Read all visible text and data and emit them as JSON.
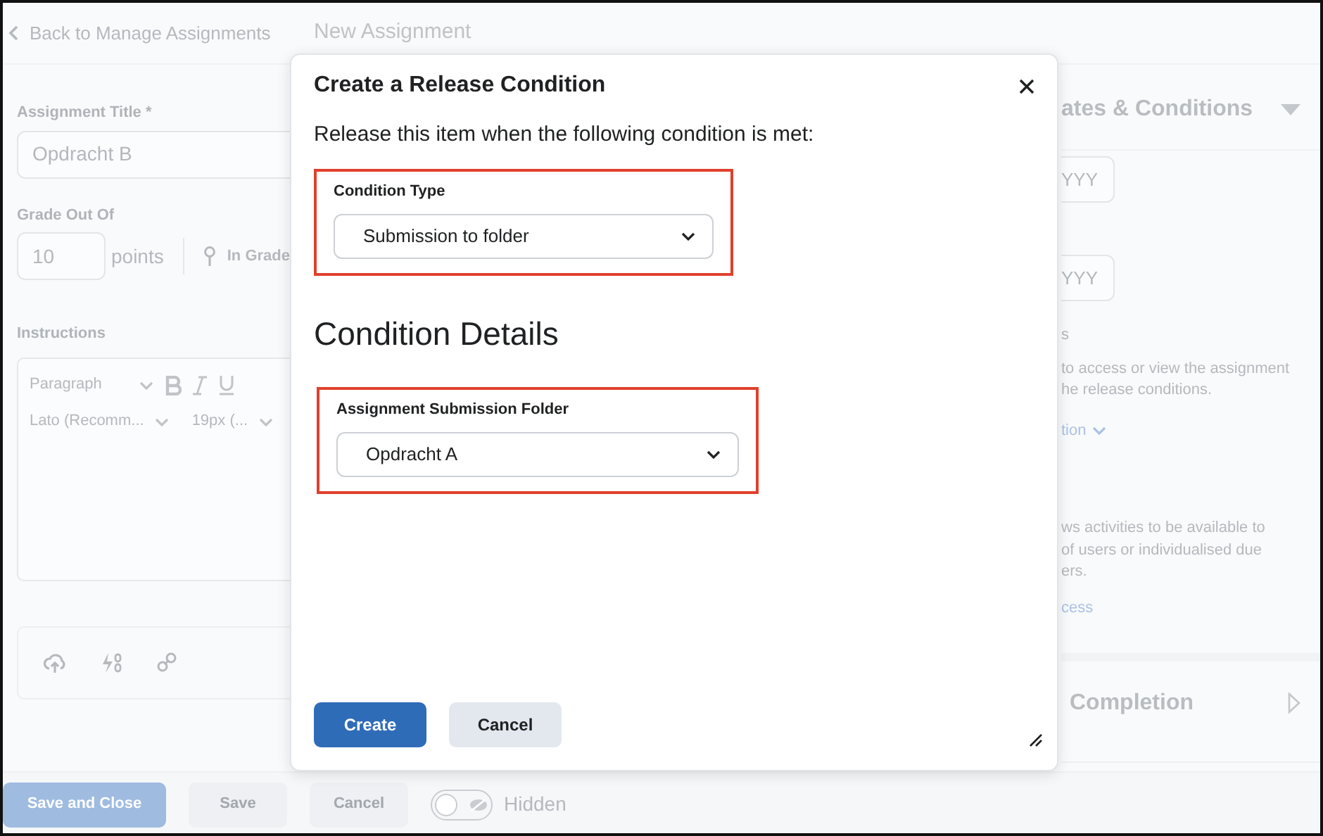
{
  "top_bar": {
    "back_link": "Back to Manage Assignments",
    "page_title": "New Assignment"
  },
  "form": {
    "title_label": "Assignment Title *",
    "title_value": "Opdracht B",
    "grade_label": "Grade Out Of",
    "grade_value": "10",
    "grade_unit": "points",
    "in_grade": "In Grade",
    "instructions_label": "Instructions",
    "editor_toolbar": {
      "paragraph": "Paragraph",
      "font": "Lato (Recomm...",
      "size": "19px (..."
    }
  },
  "side_panel": {
    "section_title": "ates & Conditions",
    "date_fields": [
      "YYY",
      "YYY"
    ],
    "fragment": "s",
    "release_text": [
      "to access or view the assignment",
      "he release conditions."
    ],
    "release_link": "tion",
    "special_text": [
      "ws activities to be available to",
      "of users or individualised due",
      "ers."
    ],
    "special_link": "cess",
    "completion_title": "Completion"
  },
  "footer": {
    "buttons": [
      {
        "label": "Save and Close",
        "kind": "primary"
      },
      {
        "label": "Save",
        "kind": "secondary"
      },
      {
        "label": "Cancel",
        "kind": "secondary"
      }
    ],
    "visibility_toggle": {
      "on": false,
      "label": "Hidden"
    }
  },
  "dialog": {
    "title": "Create a Release Condition",
    "intro": "Release this item when the following condition is met:",
    "condition_type": {
      "label": "Condition Type",
      "value": "Submission to folder"
    },
    "details_heading": "Condition Details",
    "submission_folder": {
      "label": "Assignment Submission Folder",
      "value": "Opdracht A"
    },
    "buttons": [
      {
        "label": "Create",
        "kind": "primary"
      },
      {
        "label": "Cancel",
        "kind": "secondary"
      }
    ]
  }
}
